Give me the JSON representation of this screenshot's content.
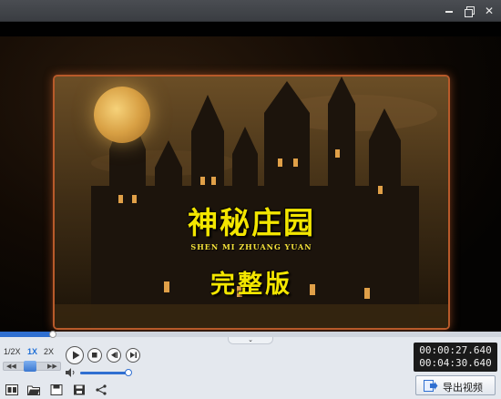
{
  "window": {
    "controls": [
      "minimize-icon",
      "restore-icon",
      "close-icon"
    ]
  },
  "video": {
    "title_main": "神秘庄园",
    "title_pinyin": "SHEN MI ZHUANG YUAN",
    "title_sub": "完整版",
    "title_color": "#f3e600",
    "frame_border_color": "#b85a2a"
  },
  "progress": {
    "played_fraction": 0.105,
    "accent": "#2f6fd1"
  },
  "speed": {
    "options": [
      "1/2X",
      "1X",
      "2X"
    ],
    "selected": "1X"
  },
  "playback": {
    "buttons": [
      "play-icon",
      "stop-icon",
      "prev-frame-icon",
      "next-frame-icon"
    ]
  },
  "volume": {
    "level": 0.95
  },
  "time": {
    "current": "00:00:27.640",
    "total": "00:04:30.640"
  },
  "toolbar": {
    "icons": [
      "subtitle-icon",
      "open-folder-icon",
      "save-icon",
      "save-as-icon",
      "share-icon"
    ],
    "export_label": "导出视频"
  }
}
